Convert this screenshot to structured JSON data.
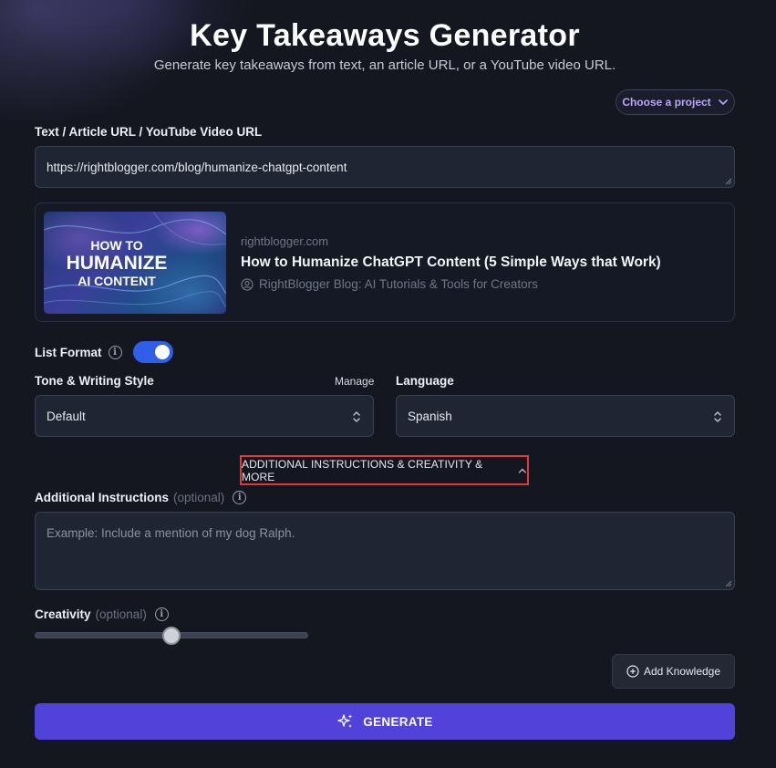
{
  "header": {
    "title": "Key Takeaways Generator",
    "subtitle": "Generate key takeaways from text, an article URL, or a YouTube video URL."
  },
  "project_select": {
    "label": "Choose a project",
    "icon": "chevron-down-icon"
  },
  "source": {
    "label": "Text / Article URL / YouTube Video URL",
    "value": "https://rightblogger.com/blog/humanize-chatgpt-content"
  },
  "preview": {
    "thumbnail_lines": [
      "HOW TO",
      "HUMANIZE",
      "AI CONTENT"
    ],
    "domain": "rightblogger.com",
    "title": "How to Humanize ChatGPT Content (5 Simple Ways that Work)",
    "author": "RightBlogger Blog: AI Tutorials & Tools for Creators",
    "author_icon": "user-circle-icon"
  },
  "list_format": {
    "label": "List Format",
    "enabled": true,
    "info_icon": "info-icon"
  },
  "tone": {
    "label": "Tone & Writing Style",
    "manage_label": "Manage",
    "value": "Default"
  },
  "language": {
    "label": "Language",
    "value": "Spanish"
  },
  "more_toggle": {
    "label": "ADDITIONAL INSTRUCTIONS & CREATIVITY & MORE",
    "icon": "chevron-up-icon"
  },
  "instructions": {
    "label": "Additional Instructions",
    "optional": "(optional)",
    "placeholder": "Example: Include a mention of my dog Ralph."
  },
  "creativity": {
    "label": "Creativity",
    "optional": "(optional)",
    "value": 0.5
  },
  "add_knowledge": {
    "label": "Add Knowledge",
    "icon": "plus-circle-icon"
  },
  "generate": {
    "label": "GENERATE",
    "icon": "sparkles-icon"
  },
  "colors": {
    "accent": "#5142d9",
    "toggle": "#2f5fe6",
    "highlight_border": "#e0393c",
    "project_text": "#b9a7f5"
  }
}
